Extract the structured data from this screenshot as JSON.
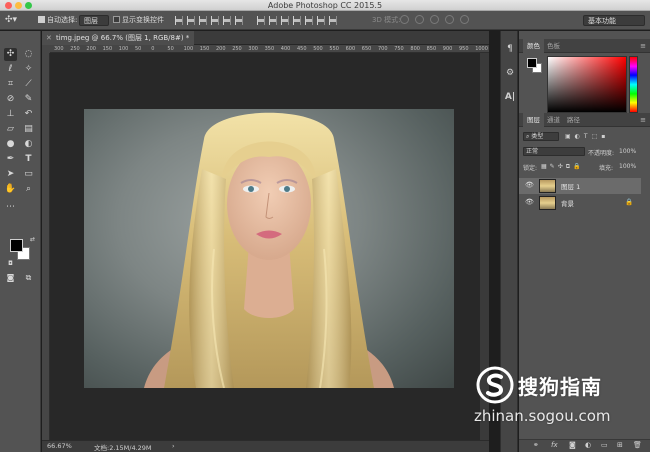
{
  "window": {
    "title": "Adobe Photoshop CC 2015.5"
  },
  "options_bar": {
    "auto_select_label": "自动选择:",
    "auto_select_value": "图层",
    "show_transform_label": "显示变换控件",
    "mode_3d_label": "3D 模式:",
    "workspace": "基本功能"
  },
  "document": {
    "tab_title": "timg.jpeg @ 66.7% (图层 1, RGB/8#) *",
    "ruler_ticks": [
      "300",
      "250",
      "200",
      "150",
      "100",
      "50",
      "0",
      "50",
      "100",
      "150",
      "200",
      "250",
      "300",
      "350",
      "400",
      "450",
      "500",
      "550",
      "600",
      "650",
      "700",
      "750",
      "800",
      "850",
      "900",
      "950",
      "1000"
    ],
    "zoom": "66.67%",
    "doc_size": "文档:2.15M/4.29M"
  },
  "toolbar": {
    "icons": [
      "move-icon",
      "marquee-icon",
      "lasso-icon",
      "magic-wand-icon",
      "crop-icon",
      "eyedropper-icon",
      "healing-brush-icon",
      "brush-icon",
      "clone-stamp-icon",
      "history-brush-icon",
      "eraser-icon",
      "gradient-icon",
      "blur-icon",
      "dodge-icon",
      "pen-icon",
      "type-icon",
      "path-selection-icon",
      "rectangle-icon",
      "hand-icon",
      "zoom-icon"
    ]
  },
  "color_panel": {
    "tabs": [
      "颜色",
      "色板"
    ],
    "foreground": "#000000",
    "background": "#ffffff",
    "hue_color": "#ff0000"
  },
  "layers_panel": {
    "tabs": [
      "图层",
      "通道",
      "路径"
    ],
    "filter_kind": "类型",
    "blend_mode": "正常",
    "opacity_label": "不透明度:",
    "opacity_value": "100%",
    "lock_label": "锁定:",
    "fill_label": "填充:",
    "fill_value": "100%",
    "layers": [
      {
        "name": "图层 1",
        "selected": true,
        "locked": false
      },
      {
        "name": "背景",
        "selected": false,
        "locked": true
      }
    ]
  },
  "watermark": {
    "brand_cn": "搜狗指南",
    "url": "zhinan.sogou.com"
  }
}
